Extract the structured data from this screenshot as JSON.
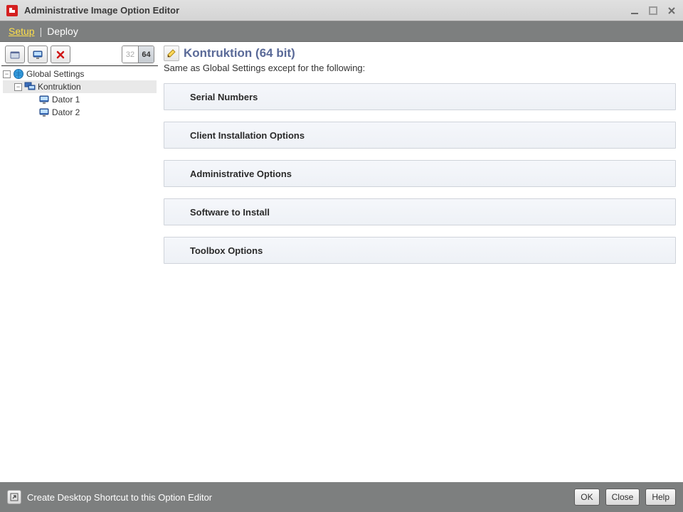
{
  "titlebar": {
    "title": "Administrative Image Option Editor"
  },
  "tabs": {
    "setup": "Setup",
    "sep": "|",
    "deploy": "Deploy"
  },
  "toolbar": {
    "bit32": "32",
    "bit64": "64"
  },
  "tree": {
    "root": "Global Settings",
    "group": "Kontruktion",
    "node1": "Dator 1",
    "node2": "Dator 2"
  },
  "header": {
    "title": "Kontruktion (64 bit)",
    "subtitle": "Same as Global Settings except for the following:"
  },
  "sections": {
    "s1": "Serial Numbers",
    "s2": "Client Installation Options",
    "s3": "Administrative Options",
    "s4": "Software to Install",
    "s5": "Toolbox Options"
  },
  "footer": {
    "shortcut": "Create Desktop Shortcut to this Option Editor",
    "ok": "OK",
    "close": "Close",
    "help": "Help"
  }
}
